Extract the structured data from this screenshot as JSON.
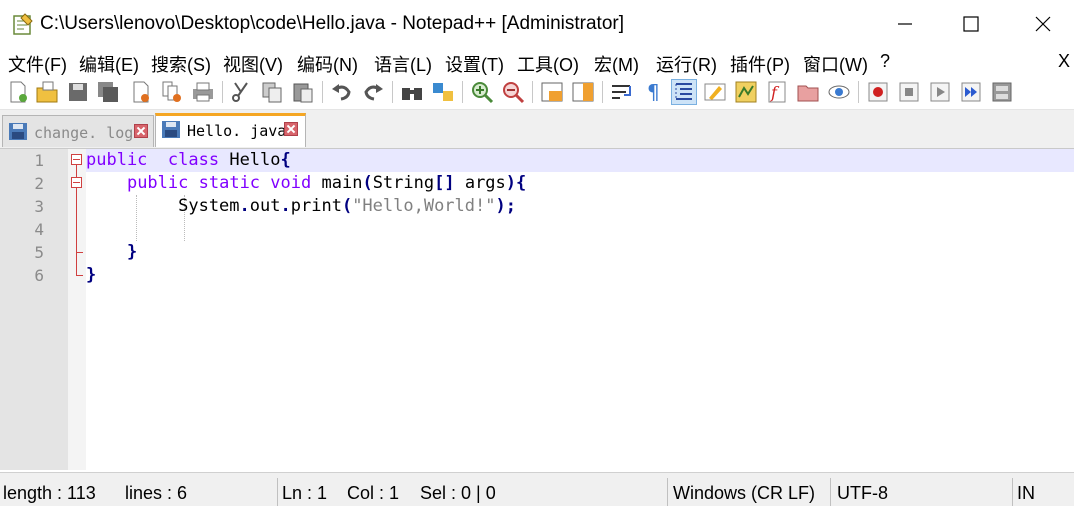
{
  "window": {
    "title": "C:\\Users\\lenovo\\Desktop\\code\\Hello.java - Notepad++ [Administrator]",
    "minimize_icon": "minimize-icon",
    "maximize_icon": "maximize-icon",
    "close_icon": "close-icon"
  },
  "menu": {
    "items": [
      "文件(F)",
      "编辑(E)",
      "搜索(S)",
      "视图(V)",
      "编码(N)",
      "语言(L)",
      "设置(T)",
      "工具(O)",
      "宏(M)",
      "运行(R)",
      "插件(P)",
      "窗口(W)",
      "?"
    ],
    "close_label": "X"
  },
  "toolbar": {
    "icons": [
      "new-file-icon",
      "open-file-icon",
      "save-icon",
      "save-all-icon",
      "close-icon",
      "close-all-icon",
      "print-icon",
      "cut-icon",
      "copy-icon",
      "paste-icon",
      "undo-icon",
      "redo-icon",
      "find-icon",
      "replace-icon",
      "zoom-in-icon",
      "zoom-out-icon",
      "sync-vertical-icon",
      "sync-horizontal-icon",
      "word-wrap-icon",
      "show-all-chars-icon",
      "indent-guide-icon",
      "udl-icon",
      "doc-map-icon",
      "function-list-icon",
      "folder-workspace-icon",
      "monitoring-icon",
      "record-macro-icon",
      "stop-record-icon",
      "play-macro-icon",
      "run-macro-multiple-icon",
      "save-macro-icon"
    ]
  },
  "tabs": [
    {
      "label": "change. log",
      "active": false
    },
    {
      "label": "Hello. java",
      "active": true
    }
  ],
  "editor": {
    "line_numbers": [
      "1",
      "2",
      "3",
      "4",
      "5",
      "6"
    ],
    "lines": [
      [
        {
          "t": "public",
          "c": "kw"
        },
        {
          "t": "  ",
          "c": "id"
        },
        {
          "t": "class",
          "c": "kw"
        },
        {
          "t": " Hello",
          "c": "id"
        },
        {
          "t": "{",
          "c": "op"
        }
      ],
      [
        {
          "t": "    ",
          "c": "id"
        },
        {
          "t": "public",
          "c": "kw"
        },
        {
          "t": " ",
          "c": "id"
        },
        {
          "t": "static",
          "c": "kw"
        },
        {
          "t": " ",
          "c": "id"
        },
        {
          "t": "void",
          "c": "kw"
        },
        {
          "t": " main",
          "c": "id"
        },
        {
          "t": "(",
          "c": "op"
        },
        {
          "t": "String",
          "c": "id"
        },
        {
          "t": "[]",
          "c": "op"
        },
        {
          "t": " args",
          "c": "id"
        },
        {
          "t": "){",
          "c": "op"
        }
      ],
      [
        {
          "t": "         System",
          "c": "id"
        },
        {
          "t": ".",
          "c": "op"
        },
        {
          "t": "out",
          "c": "id"
        },
        {
          "t": ".",
          "c": "op"
        },
        {
          "t": "print",
          "c": "id"
        },
        {
          "t": "(",
          "c": "op"
        },
        {
          "t": "\"Hello,World!\"",
          "c": "str"
        },
        {
          "t": ");",
          "c": "op"
        }
      ],
      [],
      [
        {
          "t": "    ",
          "c": "id"
        },
        {
          "t": "}",
          "c": "op"
        }
      ],
      [
        {
          "t": "}",
          "c": "op"
        }
      ]
    ],
    "current_line": 1
  },
  "status": {
    "length": "length : 113",
    "lines": "lines : 6",
    "ln": "Ln : 1",
    "col": "Col : 1",
    "sel": "Sel : 0 | 0",
    "eol": "Windows (CR LF)",
    "encoding": "UTF-8",
    "mode": "IN"
  },
  "colors": {
    "keyword": "#8000ff",
    "operator": "#000080",
    "string": "#808080",
    "current_line": "#e8e8ff",
    "active_tab_accent": "#f5a623",
    "fold_marker": "#d04040"
  }
}
